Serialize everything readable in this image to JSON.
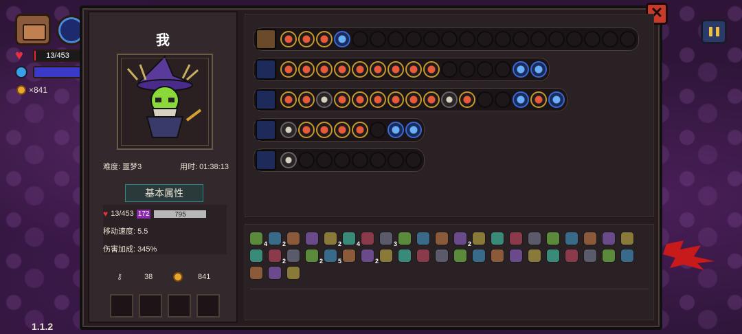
{
  "hud": {
    "hp_text": "13/453",
    "gold_text": "×841",
    "hp_fraction": 0.029
  },
  "version": "1.1.2",
  "panel": {
    "player_name": "我",
    "difficulty": "难度: 噩梦3",
    "time_used": "用时: 01:38:13",
    "section_title": "基本属性",
    "attrs": {
      "hp": "13/453",
      "mana": "172",
      "bar_value": "795",
      "move_speed": "移动速度: 5.5",
      "damage_bonus": "伤害加成: 345%"
    },
    "keys_count": "38",
    "gold_count": "841"
  },
  "weapon_rows": [
    {
      "icon": "chest-icon",
      "cells": [
        "filled",
        "filled",
        "filled",
        "blue",
        "empty",
        "empty",
        "empty",
        "empty",
        "empty",
        "empty",
        "empty",
        "empty",
        "empty",
        "empty",
        "empty",
        "empty",
        "empty",
        "empty",
        "empty",
        "empty"
      ]
    },
    {
      "icon": "staff-icon",
      "cells": [
        "filled",
        "filled",
        "filled",
        "filled",
        "filled",
        "filled",
        "filled",
        "filled",
        "filled",
        "empty",
        "empty",
        "empty",
        "empty",
        "blue",
        "blue"
      ]
    },
    {
      "icon": "staff-icon",
      "cells": [
        "filled",
        "filled",
        "grey",
        "filled",
        "filled",
        "filled",
        "filled",
        "filled",
        "filled",
        "grey",
        "filled",
        "empty",
        "empty",
        "blue",
        "filled",
        "blue"
      ]
    },
    {
      "icon": "wand-icon",
      "cells": [
        "grey",
        "filled",
        "filled",
        "filled",
        "filled",
        "empty",
        "blue",
        "blue"
      ]
    },
    {
      "icon": "wand-icon",
      "cells": [
        "grey",
        "empty",
        "empty",
        "empty",
        "empty",
        "empty",
        "empty",
        "empty"
      ]
    }
  ],
  "items": [
    {
      "c": "4"
    },
    {
      "c": "2"
    },
    {
      "c": ""
    },
    {
      "c": ""
    },
    {
      "c": "2"
    },
    {
      "c": "4"
    },
    {
      "c": ""
    },
    {
      "c": "3"
    },
    {
      "c": ""
    },
    {
      "c": ""
    },
    {
      "c": ""
    },
    {
      "c": "2"
    },
    {
      "c": ""
    },
    {
      "c": ""
    },
    {
      "c": ""
    },
    {
      "c": ""
    },
    {
      "c": ""
    },
    {
      "c": ""
    },
    {
      "c": ""
    },
    {
      "c": ""
    },
    {
      "c": ""
    },
    {
      "c": ""
    },
    {
      "c": "2"
    },
    {
      "c": ""
    },
    {
      "c": "2"
    },
    {
      "c": "5"
    },
    {
      "c": ""
    },
    {
      "c": "2"
    },
    {
      "c": ""
    },
    {
      "c": ""
    },
    {
      "c": ""
    },
    {
      "c": ""
    },
    {
      "c": ""
    },
    {
      "c": ""
    },
    {
      "c": ""
    },
    {
      "c": ""
    },
    {
      "c": ""
    },
    {
      "c": ""
    },
    {
      "c": ""
    },
    {
      "c": ""
    },
    {
      "c": ""
    },
    {
      "c": ""
    },
    {
      "c": ""
    },
    {
      "c": ""
    },
    {
      "c": ""
    }
  ],
  "colors": {
    "panel_bg": "#261c1f",
    "accent_gold": "#c89a2a",
    "hp_red": "#e02a3a",
    "mana_purple": "#8a2aa8",
    "close_red": "#c83a2a"
  }
}
